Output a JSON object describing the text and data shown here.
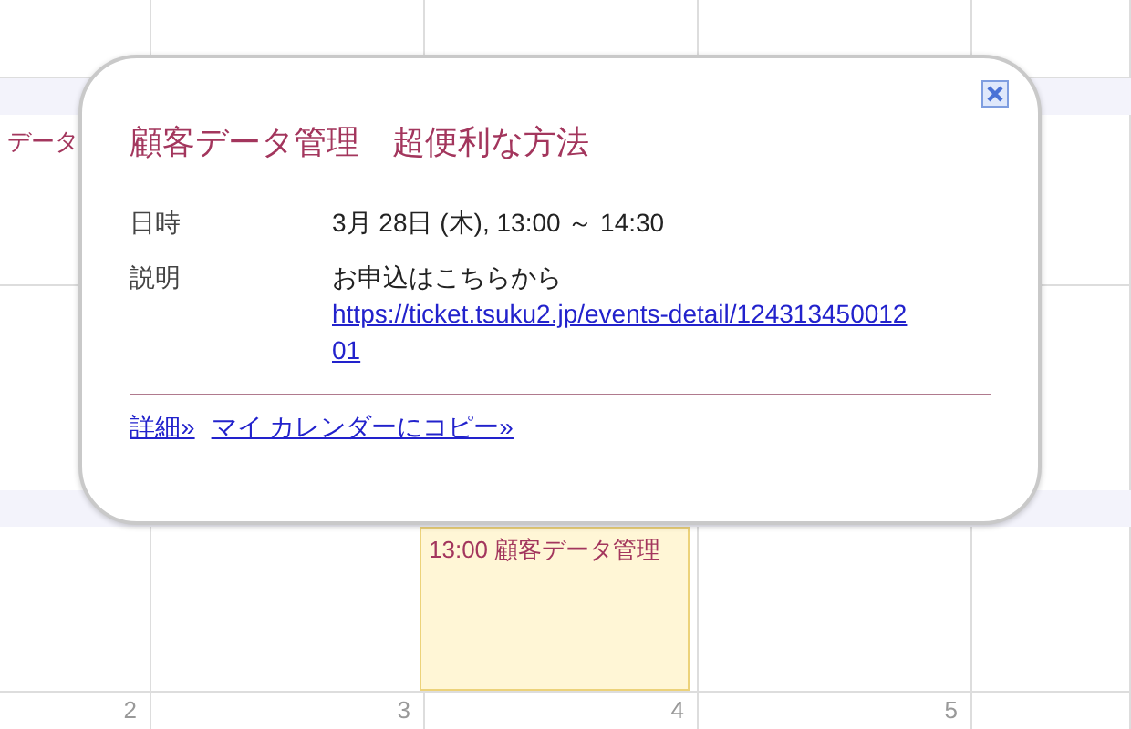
{
  "calendar": {
    "cut_event": "データ",
    "event": {
      "time": "13:00",
      "title": "顧客データ管理"
    },
    "dates": [
      "2",
      "3",
      "4",
      "5"
    ]
  },
  "popup": {
    "title": "顧客データ管理　超便利な方法",
    "fields": [
      {
        "label": "日時",
        "value": "3月 28日 (木), 13:00 ～ 14:30"
      },
      {
        "label": "説明",
        "value": "お申込はこちらから",
        "link": "https://ticket.tsuku2.jp/events-detail/12431345001201"
      }
    ],
    "links": [
      "詳細»",
      "マイ カレンダーにコピー»"
    ]
  }
}
